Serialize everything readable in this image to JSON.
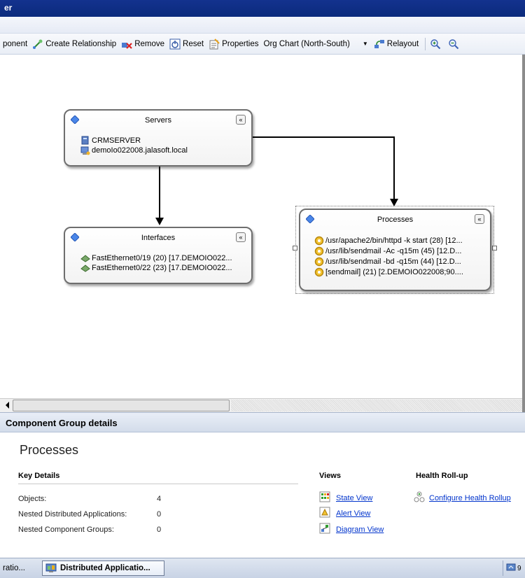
{
  "window": {
    "title": "er"
  },
  "toolbar": {
    "add_component": "ponent",
    "create_relationship": "Create Relationship",
    "remove": "Remove",
    "reset": "Reset",
    "properties": "Properties",
    "layout_selected": "Org Chart (North-South)",
    "relayout": "Relayout"
  },
  "diagram": {
    "servers": {
      "title": "Servers",
      "rows": [
        "CRMSERVER",
        "demoIo022008.jalasoft.local"
      ]
    },
    "interfaces": {
      "title": "Interfaces",
      "rows": [
        "FastEthernet0/19  (20)  [17.DEMOIO022...",
        "FastEthernet0/22  (23)  [17.DEMOIO022..."
      ]
    },
    "processes": {
      "title": "Processes",
      "rows": [
        "/usr/apache2/bin/httpd  -k start  (28)  [12...",
        "/usr/lib/sendmail  -Ac  -q15m  (45)  [12.D...",
        "/usr/lib/sendmail  -bd  -q15m  (44)  [12.D...",
        "[sendmail]  (21)  [2.DEMOIO022008;90...."
      ]
    }
  },
  "details": {
    "header": "Component Group details",
    "title": "Processes",
    "key_details": {
      "heading": "Key Details",
      "rows": [
        {
          "label": "Objects:",
          "value": "4"
        },
        {
          "label": "Nested Distributed Applications:",
          "value": "0"
        },
        {
          "label": "Nested Component Groups:",
          "value": "0"
        }
      ]
    },
    "views": {
      "heading": "Views",
      "links": [
        "State View",
        "Alert View",
        "Diagram View"
      ]
    },
    "health": {
      "heading": "Health Roll-up",
      "link": "Configure Health Rollup"
    }
  },
  "taskbar": {
    "item1": "ratio...",
    "item2": "Distributed Applicatio...",
    "tray": "9"
  }
}
